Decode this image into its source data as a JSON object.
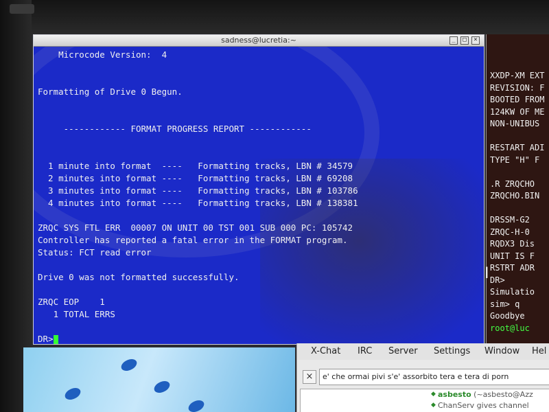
{
  "main_terminal": {
    "title": "sadness@lucretia:~",
    "buttons": [
      "_",
      "□",
      "×"
    ],
    "lines": [
      "    Microcode Version:  4",
      "",
      "",
      "Formatting of Drive 0 Begun.",
      "",
      "",
      "     ------------ FORMAT PROGRESS REPORT ------------",
      "",
      "",
      "  1 minute into format  ----   Formatting tracks, LBN # 34579",
      "  2 minutes into format ----   Formatting tracks, LBN # 69208",
      "  3 minutes into format ----   Formatting tracks, LBN # 103786",
      "  4 minutes into format ----   Formatting tracks, LBN # 138381",
      "",
      "ZRQC SYS FTL ERR  00007 ON UNIT 00 TST 001 SUB 000 PC: 105742",
      "Controller has reported a fatal error in the FORMAT program.",
      "Status: FCT read error",
      "",
      "Drive 0 was not formatted successfully.",
      "",
      "ZRQC EOP    1",
      "   1 TOTAL ERRS",
      ""
    ],
    "prompt": "DR>"
  },
  "right_terminal": {
    "lines": [
      "XXDP-XM EXT",
      "REVISION: F",
      "BOOTED FROM",
      "124KW OF ME",
      "NON-UNIBUS",
      "",
      "RESTART ADI",
      "TYPE \"H\" F",
      "",
      ".R ZRQCHO",
      "ZRQCHO.BIN",
      "",
      "DRSSM-G2",
      "ZRQC-H-0",
      "RQDX3 Dis",
      "UNIT IS F",
      "RSTRT ADR",
      "DR>",
      "Simulatio",
      "sim> q",
      "Goodbye"
    ],
    "last_line": "root@luc"
  },
  "xchat": {
    "menu": [
      "X-Chat",
      "IRC",
      "Server",
      "Settings",
      "Window",
      "Hel"
    ],
    "topic": "e' che ormai pivi s'e' assorbito tera e tera di porn",
    "close_label": "×",
    "chat": [
      {
        "nick": "asbesto",
        "text": "(~asbesto@Azz"
      },
      {
        "nick": "ChanServ",
        "text": "gives channel"
      }
    ]
  }
}
